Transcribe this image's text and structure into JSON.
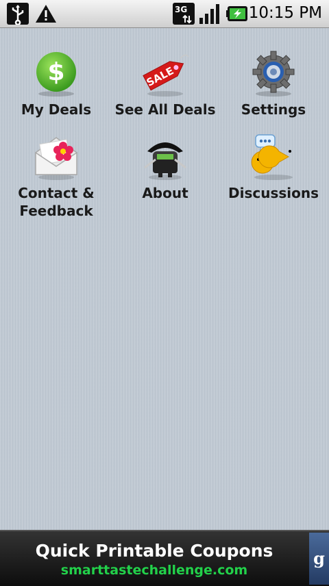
{
  "status_bar": {
    "time": "10:15 PM",
    "icons": [
      "usb-icon",
      "warning-icon",
      "3g-icon",
      "signal-icon",
      "battery-icon"
    ]
  },
  "menu": {
    "items": [
      {
        "label": "My Deals",
        "icon": "dollar-icon"
      },
      {
        "label": "See All Deals",
        "icon": "sale-tag-icon"
      },
      {
        "label": "Settings",
        "icon": "gear-icon"
      },
      {
        "label": "Contact &\nFeedback",
        "icon": "envelope-icon"
      },
      {
        "label": "About",
        "icon": "android-pirate-icon"
      },
      {
        "label": "Discussions",
        "icon": "chat-pacman-icon"
      }
    ]
  },
  "ad": {
    "title": "Quick Printable Coupons",
    "url": "smarttastechallenge.com",
    "logo": "g"
  },
  "colors": {
    "background": "#bfc9d3",
    "ad_url": "#22d14a"
  }
}
